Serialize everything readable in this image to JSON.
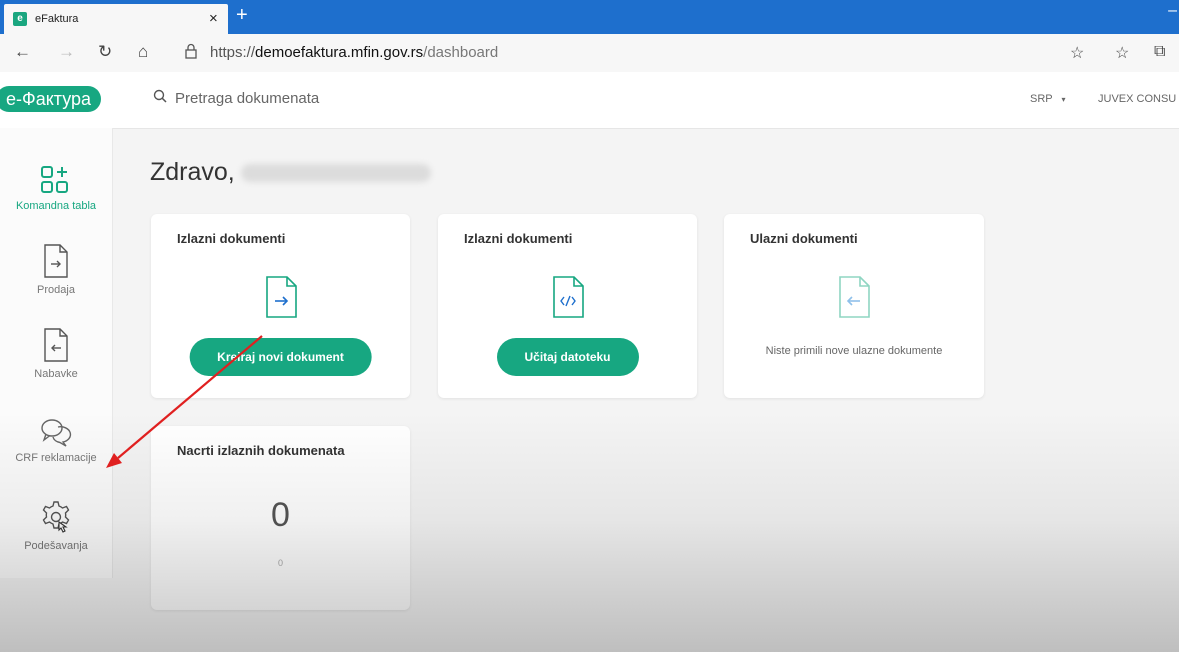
{
  "browser": {
    "tab_title": "eFaktura",
    "tab_favicon": "e",
    "tab_close": "×",
    "new_tab": "+",
    "url_prefix": "https://",
    "url_host": "demoefaktura.mfin.gov.rs",
    "url_path": "/dashboard"
  },
  "header": {
    "logo": "е-Фактура",
    "search_placeholder": "Pretraga dokumenata",
    "language": "SRP",
    "user": "JUVEX CONSU"
  },
  "sidebar": {
    "items": [
      {
        "label": "Komandna tabla",
        "icon": "dashboard-icon",
        "active": true
      },
      {
        "label": "Prodaja",
        "icon": "file-arrow-right-icon"
      },
      {
        "label": "Nabavke",
        "icon": "file-arrow-left-icon"
      },
      {
        "label": "CRF reklamacije",
        "icon": "chat-bubbles-icon"
      },
      {
        "label": "Podešavanja",
        "icon": "gear-icon"
      }
    ]
  },
  "main": {
    "greeting": "Zdravo,",
    "cards": [
      {
        "title": "Izlazni dokumenti",
        "icon": "file-arrow-right-icon",
        "button": "Kreiraj novi dokument"
      },
      {
        "title": "Izlazni dokumenti",
        "icon": "file-code-icon",
        "button": "Učitaj datoteku"
      },
      {
        "title": "Ulazni dokumenti",
        "icon": "file-arrow-left-icon",
        "message": "Niste primili nove ulazne dokumente"
      },
      {
        "title": "Nacrti izlaznih dokumenata",
        "value": "0",
        "sub_value": "0"
      }
    ]
  },
  "colors": {
    "brand": "#17a781",
    "browser_tabbar": "#1e6fcd",
    "annotation_arrow": "#e02020"
  }
}
